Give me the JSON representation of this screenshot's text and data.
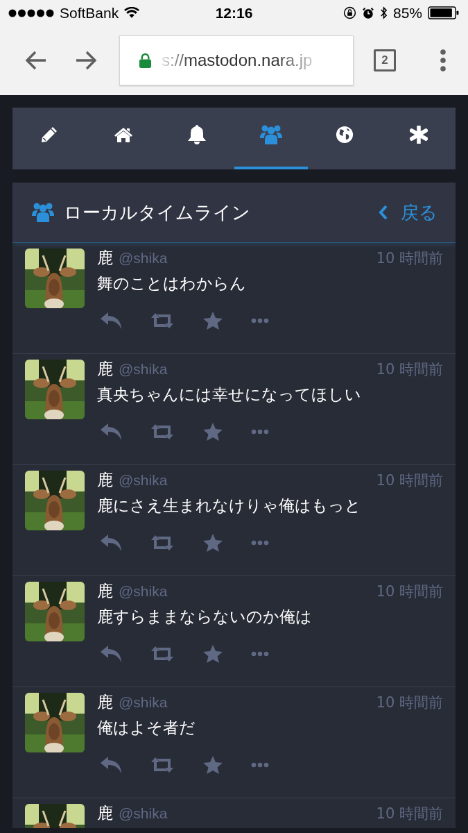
{
  "status_bar": {
    "carrier": "SoftBank",
    "time": "12:16",
    "battery": "85%"
  },
  "browser": {
    "url": "s://mastodon.nara.jp",
    "tab_count": "2"
  },
  "tabs": [
    {
      "kind": "compose",
      "selected": false
    },
    {
      "kind": "home",
      "selected": false
    },
    {
      "kind": "notifications",
      "selected": false
    },
    {
      "kind": "local",
      "selected": true
    },
    {
      "kind": "federated",
      "selected": false
    },
    {
      "kind": "more",
      "selected": false
    }
  ],
  "column": {
    "title": "ローカルタイムライン",
    "back": "戻る"
  },
  "posts": [
    {
      "name": "鹿",
      "handle": "@shika",
      "time": "10 時間前",
      "content": "舞のことはわからん"
    },
    {
      "name": "鹿",
      "handle": "@shika",
      "time": "10 時間前",
      "content": "真央ちゃんには幸せになってほしい"
    },
    {
      "name": "鹿",
      "handle": "@shika",
      "time": "10 時間前",
      "content": "鹿にさえ生まれなけりゃ俺はもっと"
    },
    {
      "name": "鹿",
      "handle": "@shika",
      "time": "10 時間前",
      "content": "鹿すらままならないのか俺は"
    },
    {
      "name": "鹿",
      "handle": "@shika",
      "time": "10 時間前",
      "content": "俺はよそ者だ"
    },
    {
      "name": "鹿",
      "handle": "@shika",
      "time": "10 時間前"
    }
  ]
}
